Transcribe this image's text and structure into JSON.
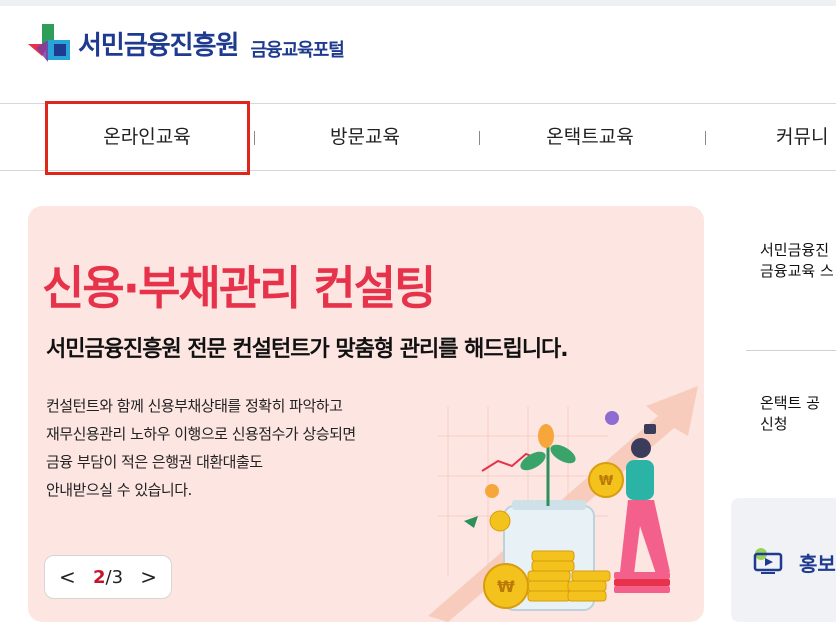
{
  "header": {
    "org_name": "서민금융진흥원",
    "portal_name": "금융교육포털"
  },
  "nav": {
    "items": [
      {
        "label": "온라인교육"
      },
      {
        "label": "방문교육"
      },
      {
        "label": "온택트교육"
      },
      {
        "label": "커뮤니"
      }
    ],
    "highlighted_index": 0
  },
  "banner": {
    "title": "신용·부채관리 컨설팅",
    "subtitle": "서민금융진흥원 전문 컨설턴트가 맞춤형 관리를 해드립니다.",
    "description": [
      "컨설턴트와 함께 신용부채상태를 정확히 파악하고",
      "재무신용관리 노하우 이행으로 신용점수가 상승되면",
      "금융 부담이 적은 은행권 대환대출도",
      "안내받으실 수 있습니다."
    ],
    "pager": {
      "prev_symbol": "<",
      "next_symbol": ">",
      "current": "2",
      "separator": "/",
      "total": "3"
    },
    "coin_symbol": "₩"
  },
  "side": {
    "item1_line1": "서민금융진",
    "item1_line2": "금융교육 스",
    "item2_line1": "온택트 공",
    "item2_line2": "신청",
    "promo_label": "홍보"
  },
  "colors": {
    "brand_blue": "#1f3b8f",
    "banner_bg": "#fde6e2",
    "title_red": "#e6324a",
    "highlight_red": "#e0251b"
  }
}
